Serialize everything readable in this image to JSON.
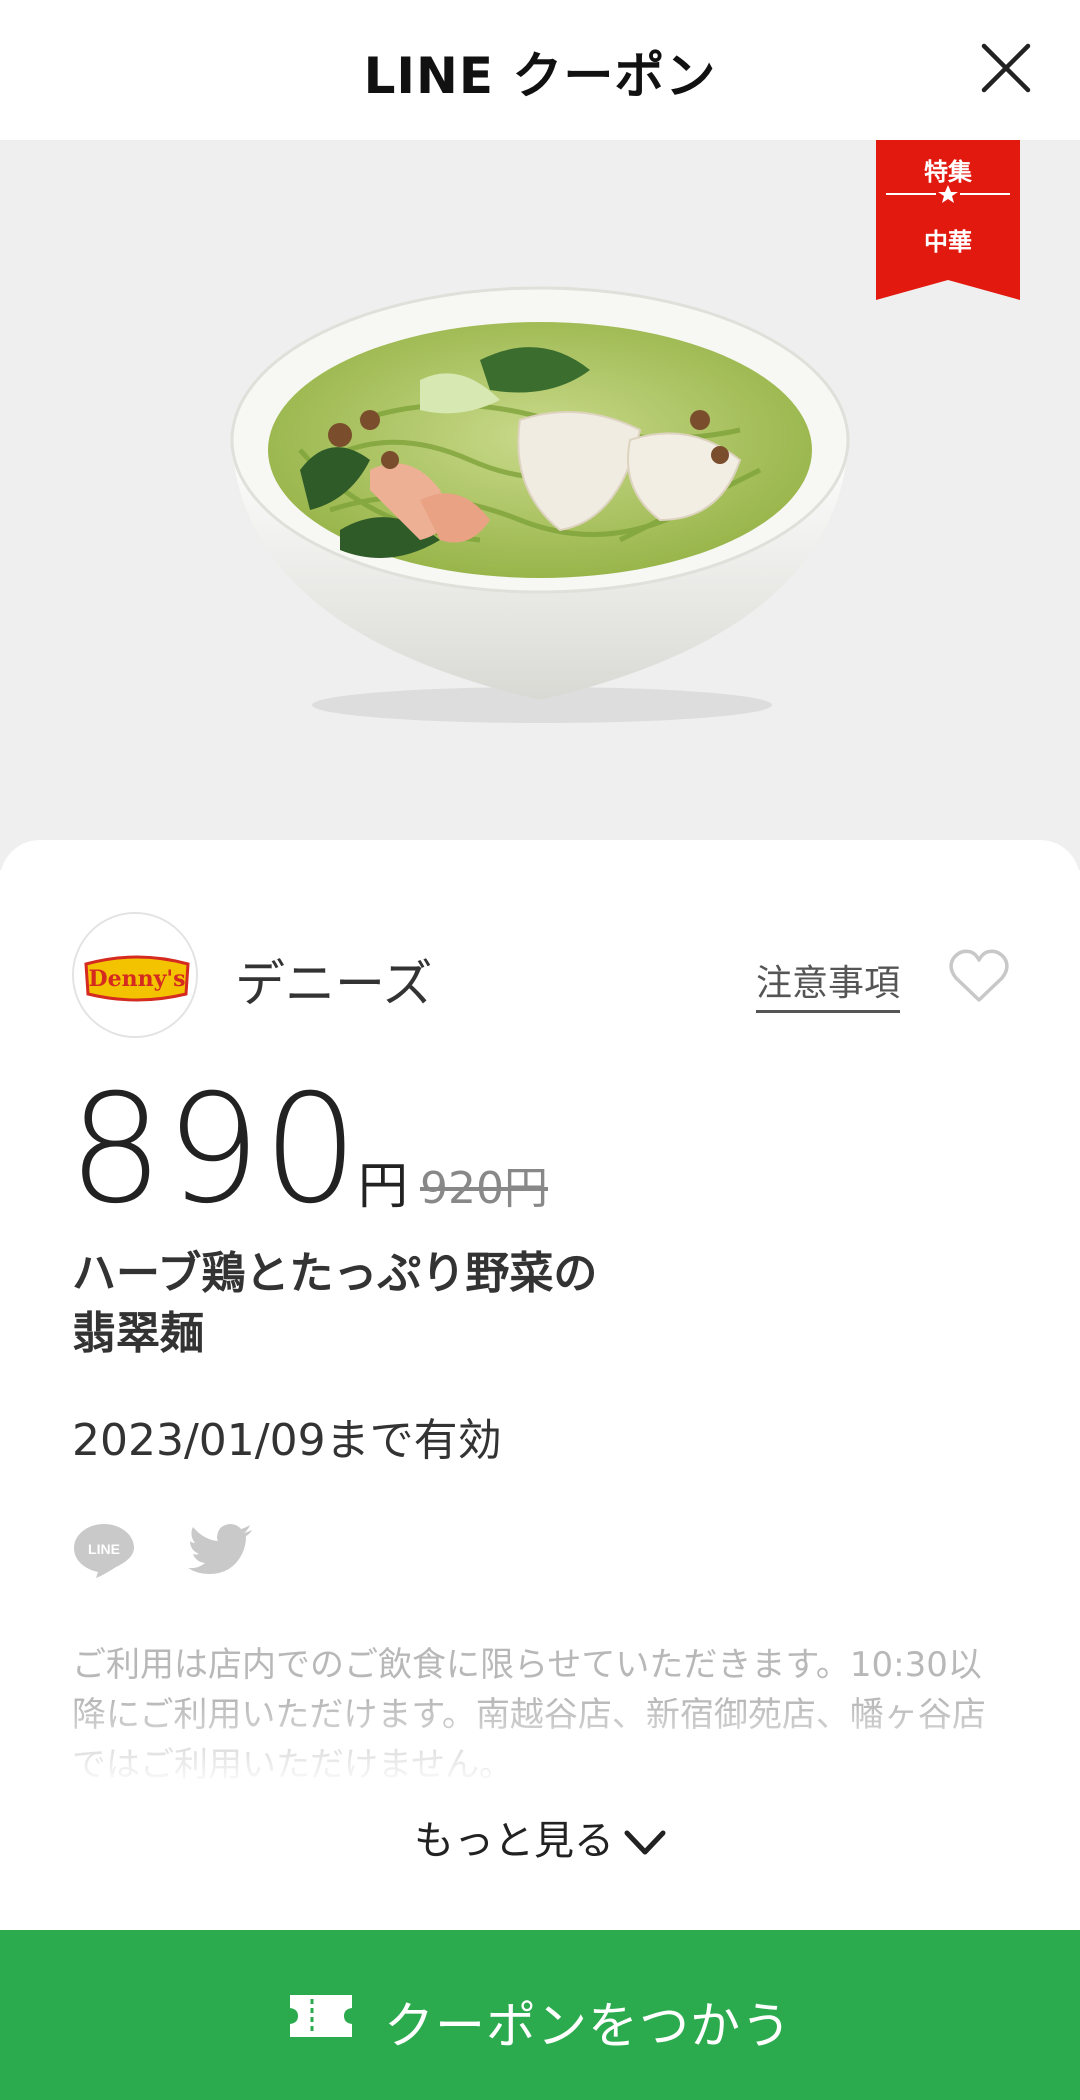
{
  "header": {
    "title": "LINE クーポン"
  },
  "badge": {
    "line1": "特集",
    "line2": "中華",
    "color": "#e2190f"
  },
  "store": {
    "name": "デニーズ",
    "notice_label": "注意事項",
    "logo_text": "Denny's"
  },
  "coupon": {
    "price": "890",
    "unit": "円",
    "original_price": "920円",
    "title_line1": "ハーブ鶏とたっぷり野菜の",
    "title_line2": "翡翠麺",
    "valid_until": "2023/01/09まで有効",
    "terms": "ご利用は店内でのご飲食に限らせていただきます。10:30以降にご利用いただけます。南越谷店、新宿御苑店、幡ヶ谷店ではご利用いただけません。"
  },
  "share": {
    "line_label": "LINE"
  },
  "more": {
    "label": "もっと見る"
  },
  "action": {
    "use_label": "クーポンをつかう",
    "color": "#2bab4e"
  }
}
